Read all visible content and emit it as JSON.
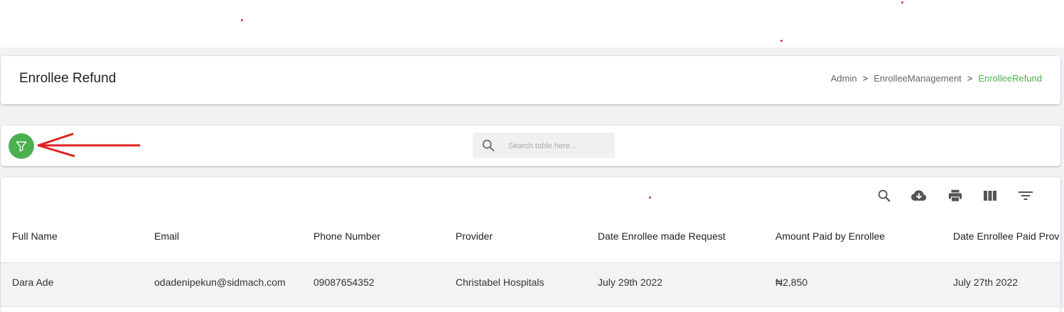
{
  "header": {
    "title": "Enrollee Refund",
    "breadcrumbs": [
      "Admin",
      "EnrolleeManagement",
      "EnrolleeRefund"
    ],
    "separator": ">"
  },
  "filter": {
    "icon": "filter-icon",
    "color": "#4caf50"
  },
  "search": {
    "placeholder": "Search table here..."
  },
  "toolbar": {
    "icons": [
      "search-icon",
      "download-icon",
      "print-icon",
      "view-columns-icon",
      "filter-list-icon"
    ]
  },
  "table": {
    "columns": [
      "Full Name",
      "Email",
      "Phone Number",
      "Provider",
      "Date Enrollee made Request",
      "Amount Paid by Enrollee",
      "Date Enrollee Paid Prov"
    ],
    "rows": [
      [
        "Dara Ade",
        "odadenipekun@sidmach.com",
        "09087654352",
        "Christabel Hospitals",
        "July 29th 2022",
        "₦2,850",
        "July 27th 2022"
      ]
    ]
  },
  "colors": {
    "accent": "#4caf50",
    "arrow": "#e02020"
  }
}
